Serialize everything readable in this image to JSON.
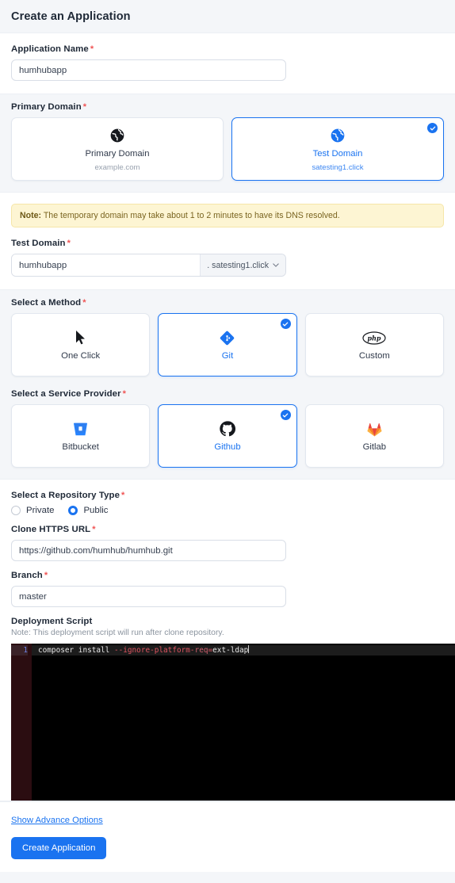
{
  "header": {
    "title": "Create an Application"
  },
  "app_name": {
    "label": "Application Name",
    "value": "humhubapp",
    "placeholder": "Application Name"
  },
  "primary_domain": {
    "label": "Primary Domain",
    "options": [
      {
        "title": "Primary Domain",
        "sub": "example.com",
        "icon": "globe-icon",
        "selected": false
      },
      {
        "title": "Test Domain",
        "sub": "satesting1.click",
        "icon": "globe-icon",
        "selected": true
      }
    ]
  },
  "note": {
    "prefix": "Note:",
    "text": " The temporary domain may take about 1 to 2 minutes to have its DNS resolved."
  },
  "test_domain": {
    "label": "Test Domain",
    "value": "humhubapp",
    "placeholder": "Test Domain",
    "suffix": ". satesting1.click"
  },
  "method": {
    "label": "Select a Method",
    "options": [
      {
        "title": "One Click",
        "icon": "cursor-icon",
        "selected": false
      },
      {
        "title": "Git",
        "icon": "git-icon",
        "selected": true
      },
      {
        "title": "Custom",
        "icon": "php-icon",
        "selected": false
      }
    ]
  },
  "provider": {
    "label": "Select a Service Provider",
    "options": [
      {
        "title": "Bitbucket",
        "icon": "bitbucket-icon",
        "selected": false
      },
      {
        "title": "Github",
        "icon": "github-icon",
        "selected": true
      },
      {
        "title": "Gitlab",
        "icon": "gitlab-icon",
        "selected": false
      }
    ]
  },
  "repo_type": {
    "label": "Select a Repository Type",
    "options": [
      {
        "label": "Private",
        "selected": false
      },
      {
        "label": "Public",
        "selected": true
      }
    ]
  },
  "clone_url": {
    "label": "Clone HTTPS URL",
    "value": "https://github.com/humhub/humhub.git",
    "placeholder": "Clone HTTPS URL"
  },
  "branch": {
    "label": "Branch",
    "value": "master",
    "placeholder": "Branch"
  },
  "deployment": {
    "label": "Deployment Script",
    "note": "Note: This deployment script will run after clone repository.",
    "line_number": "1",
    "code": {
      "part1": "composer install ",
      "part2": "--ignore-platform-",
      "part3": "req",
      "part4": "=",
      "part5": "ext-ldap"
    }
  },
  "footer": {
    "advance_link": "Show Advance Options",
    "submit_label": "Create Application"
  },
  "colors": {
    "accent": "#1a73f0",
    "required": "#f05454",
    "note_bg": "#fdf5d3",
    "page_bg": "#f4f6f9"
  }
}
